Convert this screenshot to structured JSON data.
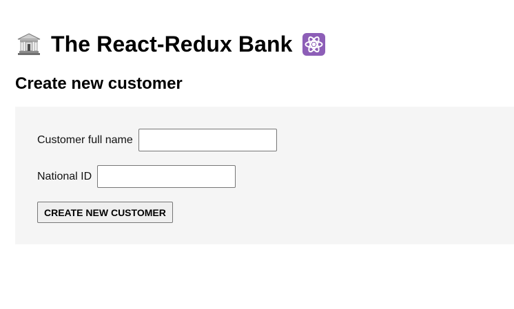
{
  "app": {
    "title": "The React-Redux Bank",
    "leading_icon": "bank-icon",
    "trailing_icon": "react-atom-icon",
    "colors": {
      "page_background": "#ffffff",
      "form_background": "#f5f5f5",
      "react_icon_background": "#8d5eb7"
    }
  },
  "create_customer": {
    "title": "Create new customer",
    "fields": {
      "full_name": {
        "label": "Customer full name",
        "value": "",
        "placeholder": ""
      },
      "national_id": {
        "label": "National ID",
        "value": "",
        "placeholder": ""
      }
    },
    "submit_label": "CREATE NEW CUSTOMER"
  }
}
